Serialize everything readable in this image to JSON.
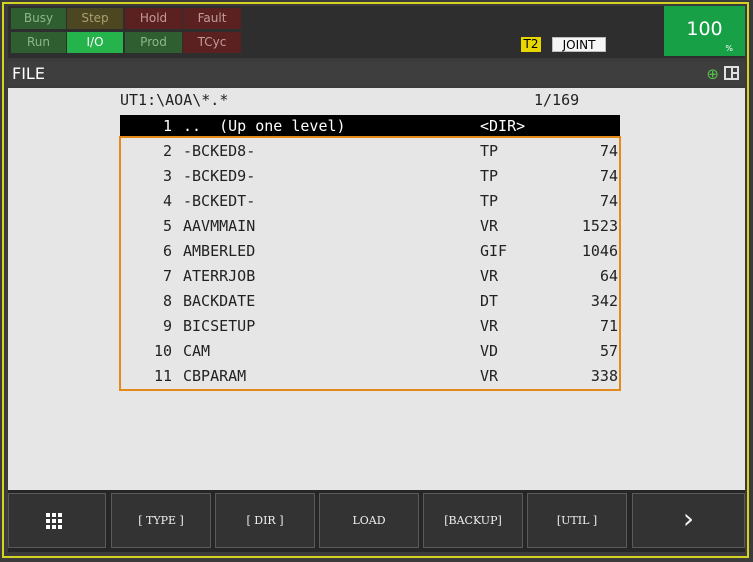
{
  "status": {
    "lamps": [
      {
        "label": "Busy",
        "color": "#2f5e30",
        "text_color": "#8fb58d"
      },
      {
        "label": "Step",
        "color": "#4c4721",
        "text_color": "#a9a06e"
      },
      {
        "label": "Hold",
        "color": "#5b2121",
        "text_color": "#c29a9a"
      },
      {
        "label": "Fault",
        "color": "#5b2121",
        "text_color": "#c29a9a"
      },
      {
        "label": "Run",
        "color": "#2f5e30",
        "text_color": "#8fb58d"
      },
      {
        "label": "I/O",
        "color": "#25b44b",
        "text_color": "#ffffff"
      },
      {
        "label": "Prod",
        "color": "#2f5e30",
        "text_color": "#8fb58d"
      },
      {
        "label": "TCyc",
        "color": "#5b2121",
        "text_color": "#c29a9a"
      }
    ],
    "mode": "T2",
    "coord": "JOINT",
    "override": "100",
    "override_unit": "%"
  },
  "title": {
    "text": "FILE",
    "zoom_icon": "zoom-in-icon",
    "layout_icon": "split-screen-icon"
  },
  "listing": {
    "path": "UT1:\\AOA\\*.*",
    "page": "1/169",
    "rows": [
      {
        "num": "1",
        "name": "..  (Up one level)",
        "type": "<DIR>",
        "size": ""
      },
      {
        "num": "2",
        "name": "-BCKED8-",
        "type": "TP",
        "size": "74"
      },
      {
        "num": "3",
        "name": "-BCKED9-",
        "type": "TP",
        "size": "74"
      },
      {
        "num": "4",
        "name": "-BCKEDT-",
        "type": "TP",
        "size": "74"
      },
      {
        "num": "5",
        "name": "AAVMMAIN",
        "type": "VR",
        "size": "1523"
      },
      {
        "num": "6",
        "name": "AMBERLED",
        "type": "GIF",
        "size": "1046"
      },
      {
        "num": "7",
        "name": "ATERRJOB",
        "type": "VR",
        "size": "64"
      },
      {
        "num": "8",
        "name": "BACKDATE",
        "type": "DT",
        "size": "342"
      },
      {
        "num": "9",
        "name": "BICSETUP",
        "type": "VR",
        "size": "71"
      },
      {
        "num": "10",
        "name": "CAM",
        "type": "VD",
        "size": "57"
      },
      {
        "num": "11",
        "name": "CBPARAM",
        "type": "VR",
        "size": "338"
      }
    ]
  },
  "fkeys": {
    "menu_icon": "grid-menu-icon",
    "f1": "[ TYPE ]",
    "f2": "[ DIR ]",
    "f3": "LOAD",
    "f4": "[BACKUP]",
    "f5": "[UTIL ]",
    "next_icon": "chevron-right-icon",
    "next_symbol": "›"
  },
  "colors": {
    "frame": "#d4d223",
    "mode_badge": "#e8d600",
    "override_bg": "#17a046",
    "selection_bg": "#000000",
    "highlight_border": "#e38a1b"
  }
}
